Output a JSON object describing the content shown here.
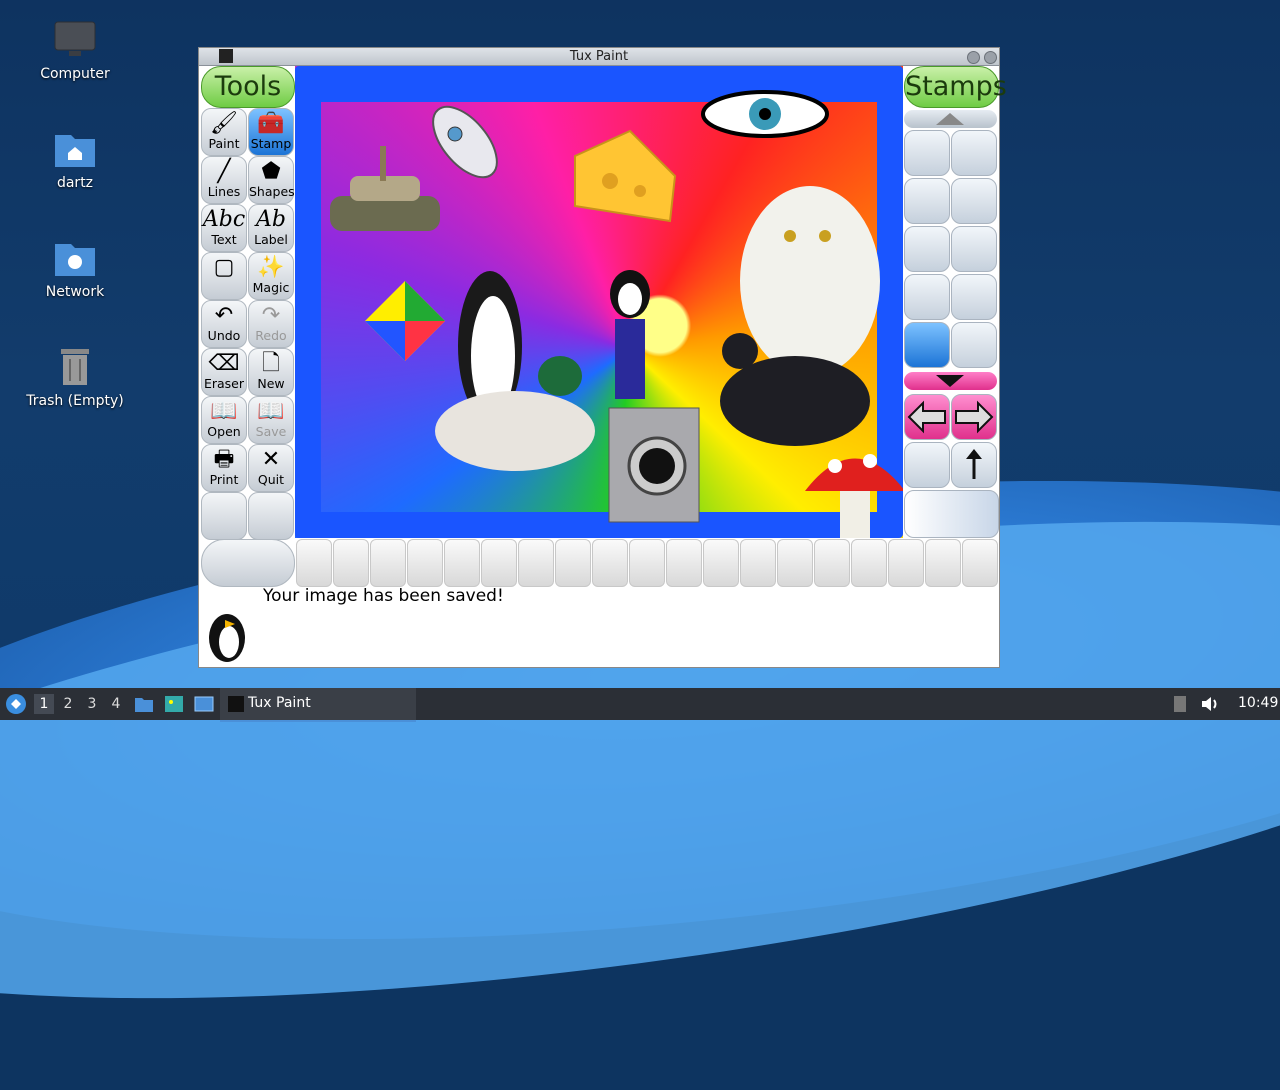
{
  "desktop": {
    "icons": [
      {
        "label": "Computer",
        "icon": "computer-icon"
      },
      {
        "label": "dartz",
        "icon": "home-folder-icon"
      },
      {
        "label": "Network",
        "icon": "network-folder-icon"
      },
      {
        "label": "Trash (Empty)",
        "icon": "trash-icon"
      }
    ]
  },
  "window": {
    "title": "Tux Paint",
    "tools_header": "Tools",
    "stamps_header": "Stamps",
    "tools": [
      {
        "label": "Paint",
        "icon": "paintbrush-icon",
        "active": false
      },
      {
        "label": "Stamp",
        "icon": "stamp-icon",
        "active": true
      },
      {
        "label": "Lines",
        "icon": "lines-icon",
        "active": false
      },
      {
        "label": "Shapes",
        "icon": "pentagon-icon",
        "active": false
      },
      {
        "label": "Text",
        "icon": "text-icon",
        "active": false
      },
      {
        "label": "Label",
        "icon": "label-icon",
        "active": false
      },
      {
        "label": "",
        "icon": "fill-icon",
        "active": false
      },
      {
        "label": "Magic",
        "icon": "magic-wand-icon",
        "active": false
      },
      {
        "label": "Undo",
        "icon": "undo-icon",
        "active": false
      },
      {
        "label": "Redo",
        "icon": "redo-icon",
        "active": false,
        "disabled": true
      },
      {
        "label": "Eraser",
        "icon": "eraser-icon",
        "active": false
      },
      {
        "label": "New",
        "icon": "new-page-icon",
        "active": false
      },
      {
        "label": "Open",
        "icon": "open-book-icon",
        "active": false
      },
      {
        "label": "Save",
        "icon": "save-book-icon",
        "active": false,
        "disabled": true
      },
      {
        "label": "Print",
        "icon": "printer-icon",
        "active": false
      },
      {
        "label": "Quit",
        "icon": "quit-x-icon",
        "active": false
      }
    ],
    "status_message": "Your image has been saved!",
    "stamps": [
      "lunar-lander-icon",
      "rocket-icon",
      "rocket-icon",
      "rocket-flame-icon",
      "rocket-icon",
      "shuttle-icon",
      "satellite-icon",
      "astronaut-icon",
      "rocket-cartoon-icon",
      "satellite-probe-icon"
    ]
  },
  "taskbar": {
    "workspaces": [
      "1",
      "2",
      "3",
      "4"
    ],
    "active_workspace": "1",
    "task_label": "Tux Paint",
    "clock": "10:49"
  }
}
